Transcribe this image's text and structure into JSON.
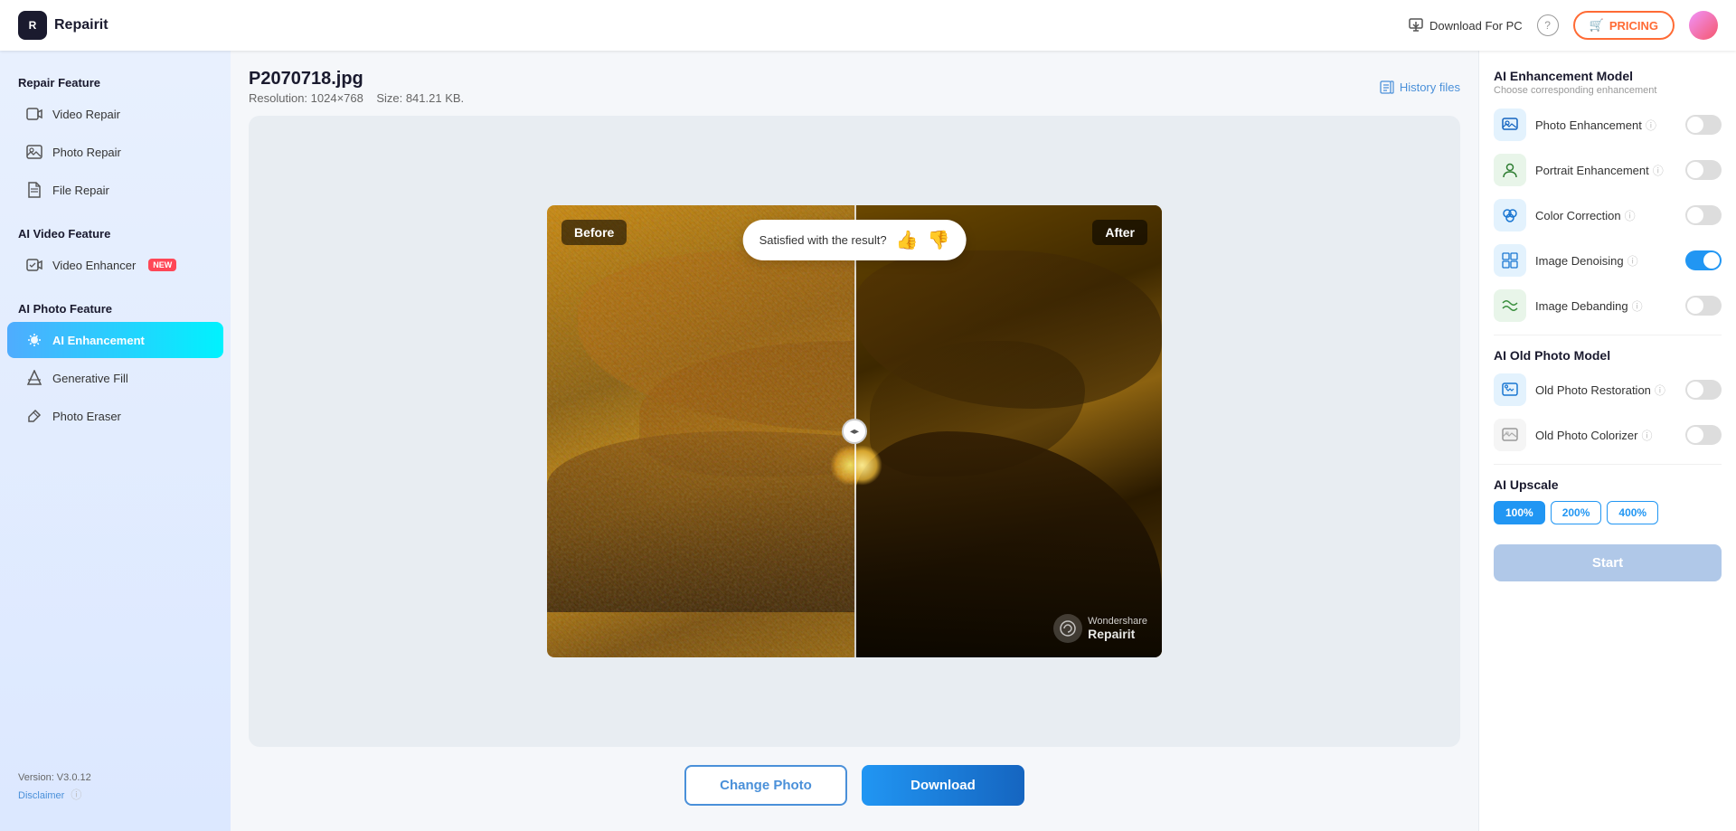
{
  "header": {
    "app_name": "Repairit",
    "download_for_pc": "Download For PC",
    "pricing_label": "PRICING",
    "cart_icon": "🛒"
  },
  "sidebar": {
    "repair_feature_title": "Repair Feature",
    "items_repair": [
      {
        "id": "video-repair",
        "label": "Video Repair",
        "icon": "▶"
      },
      {
        "id": "photo-repair",
        "label": "Photo Repair",
        "icon": "🖼"
      },
      {
        "id": "file-repair",
        "label": "File Repair",
        "icon": "📄"
      }
    ],
    "ai_video_title": "AI Video Feature",
    "items_ai_video": [
      {
        "id": "video-enhancer",
        "label": "Video Enhancer",
        "icon": "✨",
        "badge": "NEW"
      }
    ],
    "ai_photo_title": "AI Photo Feature",
    "items_ai_photo": [
      {
        "id": "ai-enhancement",
        "label": "AI Enhancement",
        "icon": "✦",
        "active": true
      },
      {
        "id": "generative-fill",
        "label": "Generative Fill",
        "icon": "⬡"
      },
      {
        "id": "photo-eraser",
        "label": "Photo Eraser",
        "icon": "◇"
      }
    ],
    "version": "Version: V3.0.12",
    "disclaimer": "Disclaimer"
  },
  "file_info": {
    "filename": "P2070718.jpg",
    "resolution_label": "Resolution: 1024×768",
    "size_label": "Size: 841.21 KB.",
    "history_label": "History files"
  },
  "comparison": {
    "before_label": "Before",
    "after_label": "After",
    "satisfaction_text": "Satisfied with the result?",
    "thumb_up": "👍",
    "thumb_down": "👎",
    "watermark_brand": "Repairit",
    "watermark_sub": "Wondershare",
    "divider_arrows": "◂▸"
  },
  "actions": {
    "change_photo": "Change Photo",
    "download": "Download"
  },
  "right_panel": {
    "ai_enhancement_title": "AI Enhancement Model",
    "ai_enhancement_subtitle": "Choose corresponding enhancement",
    "features": [
      {
        "id": "photo-enhancement",
        "label": "Photo Enhancement",
        "icon": "🖼",
        "icon_class": "icon-photo-enhance",
        "on": false
      },
      {
        "id": "portrait-enhancement",
        "label": "Portrait Enhancement",
        "icon": "👤",
        "icon_class": "icon-portrait",
        "on": false
      },
      {
        "id": "color-correction",
        "label": "Color Correction",
        "icon": "🎨",
        "icon_class": "icon-color",
        "on": false
      },
      {
        "id": "image-denoising",
        "label": "Image Denoising",
        "icon": "🔲",
        "icon_class": "icon-denoise",
        "on": true
      },
      {
        "id": "image-debanding",
        "label": "Image Debanding",
        "icon": "〰",
        "icon_class": "icon-debanding",
        "on": false
      }
    ],
    "ai_old_photo_title": "AI Old Photo Model",
    "old_photo_features": [
      {
        "id": "old-photo-restoration",
        "label": "Old Photo Restoration",
        "icon": "🕰",
        "icon_class": "icon-old-restore",
        "on": false
      },
      {
        "id": "old-photo-colorizer",
        "label": "Old Photo Colorizer",
        "icon": "🎭",
        "icon_class": "icon-old-colorize",
        "on": false
      }
    ],
    "ai_upscale_title": "AI Upscale",
    "upscale_options": [
      "100%",
      "200%",
      "400%"
    ],
    "upscale_selected": "100%",
    "start_label": "Start"
  }
}
